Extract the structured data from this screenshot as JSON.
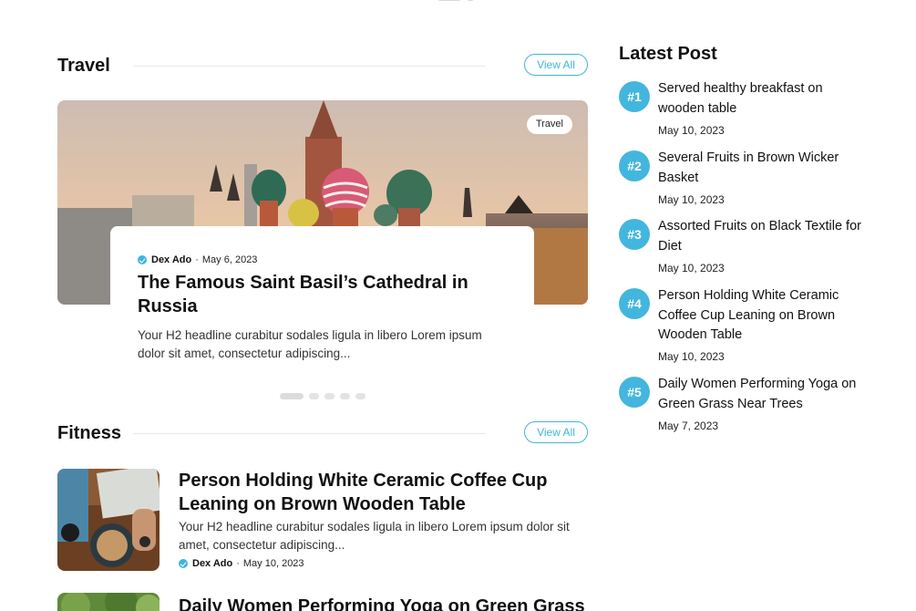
{
  "travel": {
    "heading": "Travel",
    "view_all": "View All",
    "featured": {
      "tag": "Travel",
      "author": "Dex Ado",
      "date": "May 6, 2023",
      "title": "The Famous Saint Basil’s Cathedral in Russia",
      "excerpt": "Your H2 headline curabitur sodales ligula in libero Lorem ipsum dolor sit amet, consectetur adipiscing..."
    }
  },
  "fitness": {
    "heading": "Fitness",
    "view_all": "View All",
    "posts": [
      {
        "title": "Person Holding White Ceramic Coffee Cup Leaning on Brown Wooden Table",
        "excerpt": "Your H2 headline curabitur sodales ligula in libero Lorem ipsum dolor sit amet, consectetur adipiscing...",
        "author": "Dex Ado",
        "date": "May 10, 2023"
      },
      {
        "title": "Daily Women Performing Yoga on Green Grass"
      }
    ]
  },
  "latest": {
    "heading": "Latest Post",
    "posts": [
      {
        "rank": "#1",
        "title": "Served healthy breakfast on wooden table",
        "date": "May 10, 2023"
      },
      {
        "rank": "#2",
        "title": "Several Fruits in Brown Wicker Basket",
        "date": "May 10, 2023"
      },
      {
        "rank": "#3",
        "title": "Assorted Fruits on Black Textile for Diet",
        "date": "May 10, 2023"
      },
      {
        "rank": "#4",
        "title": "Person Holding White Ceramic Coffee Cup Leaning on Brown Wooden Table",
        "date": "May 10, 2023"
      },
      {
        "rank": "#5",
        "title": "Daily Women Performing Yoga on Green Grass Near Trees",
        "date": "May 7, 2023"
      }
    ]
  },
  "colors": {
    "accent": "#43b6de",
    "text": "#111111"
  }
}
